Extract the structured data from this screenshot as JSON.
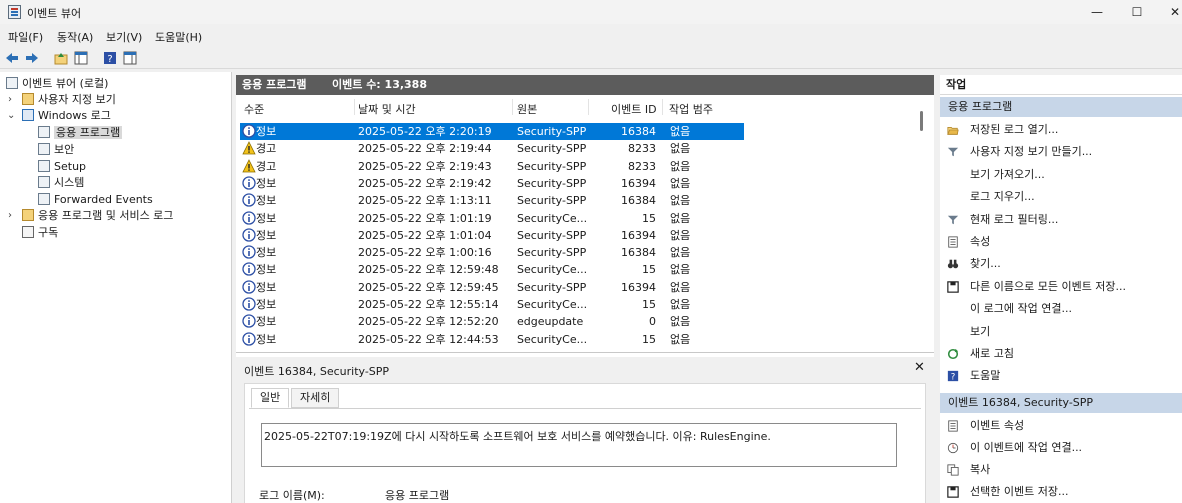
{
  "window": {
    "title": "이벤트 뷰어",
    "minimize": "—",
    "maximize": "☐",
    "close": "✕"
  },
  "menu": [
    "파일(F)",
    "동작(A)",
    "보기(V)",
    "도움말(H)"
  ],
  "tree": {
    "root": "이벤트 뷰어 (로컬)",
    "custom_views": "사용자 지정 보기",
    "windows_logs": "Windows 로그",
    "logs": [
      "응용 프로그램",
      "보안",
      "Setup",
      "시스템",
      "Forwarded Events"
    ],
    "app_service_logs": "응용 프로그램 및 서비스 로그",
    "subscriptions": "구독"
  },
  "center": {
    "log_name": "응용 프로그램",
    "count_label": "이벤트 수: 13,388",
    "columns": [
      "수준",
      "날짜 및 시간",
      "원본",
      "이벤트 ID",
      "작업 범주"
    ],
    "rows": [
      {
        "level": "정보",
        "kind": "info",
        "datetime": "2025-05-22 오후 2:20:19",
        "source": "Security-SPP",
        "id": "16384",
        "category": "없음"
      },
      {
        "level": "경고",
        "kind": "warn",
        "datetime": "2025-05-22 오후 2:19:44",
        "source": "Security-SPP",
        "id": "8233",
        "category": "없음"
      },
      {
        "level": "경고",
        "kind": "warn",
        "datetime": "2025-05-22 오후 2:19:43",
        "source": "Security-SPP",
        "id": "8233",
        "category": "없음"
      },
      {
        "level": "정보",
        "kind": "info",
        "datetime": "2025-05-22 오후 2:19:42",
        "source": "Security-SPP",
        "id": "16394",
        "category": "없음"
      },
      {
        "level": "정보",
        "kind": "info",
        "datetime": "2025-05-22 오후 1:13:11",
        "source": "Security-SPP",
        "id": "16384",
        "category": "없음"
      },
      {
        "level": "정보",
        "kind": "info",
        "datetime": "2025-05-22 오후 1:01:19",
        "source": "SecurityCe...",
        "id": "15",
        "category": "없음"
      },
      {
        "level": "정보",
        "kind": "info",
        "datetime": "2025-05-22 오후 1:01:04",
        "source": "Security-SPP",
        "id": "16394",
        "category": "없음"
      },
      {
        "level": "정보",
        "kind": "info",
        "datetime": "2025-05-22 오후 1:00:16",
        "source": "Security-SPP",
        "id": "16384",
        "category": "없음"
      },
      {
        "level": "정보",
        "kind": "info",
        "datetime": "2025-05-22 오후 12:59:48",
        "source": "SecurityCe...",
        "id": "15",
        "category": "없음"
      },
      {
        "level": "정보",
        "kind": "info",
        "datetime": "2025-05-22 오후 12:59:45",
        "source": "Security-SPP",
        "id": "16394",
        "category": "없음"
      },
      {
        "level": "정보",
        "kind": "info",
        "datetime": "2025-05-22 오후 12:55:14",
        "source": "SecurityCe...",
        "id": "15",
        "category": "없음"
      },
      {
        "level": "정보",
        "kind": "info",
        "datetime": "2025-05-22 오후 12:52:20",
        "source": "edgeupdate",
        "id": "0",
        "category": "없음"
      },
      {
        "level": "정보",
        "kind": "info",
        "datetime": "2025-05-22 오후 12:44:53",
        "source": "SecurityCe...",
        "id": "15",
        "category": "없음"
      }
    ]
  },
  "detail": {
    "title": "이벤트 16384, Security-SPP",
    "close": "✕",
    "tabs": [
      "일반",
      "자세히"
    ],
    "message": "2025-05-22T07:19:19Z에 다시 시작하도록 소프트웨어 보호 서비스를 예약했습니다. 이유: RulesEngine.",
    "log_name_label": "로그 이름(M):",
    "log_name_value": "응용 프로그램"
  },
  "actions": {
    "title": "작업",
    "section1": "응용 프로그램",
    "items1": [
      {
        "label": "저장된 로그 열기...",
        "icon": "folder-open-icon"
      },
      {
        "label": "사용자 지정 보기 만들기...",
        "icon": "filter-icon"
      },
      {
        "label": "보기 가져오기...",
        "icon": ""
      },
      {
        "label": "로그 지우기...",
        "icon": ""
      },
      {
        "label": "현재 로그 필터링...",
        "icon": "filter-icon"
      },
      {
        "label": "속성",
        "icon": "properties-icon"
      },
      {
        "label": "찾기...",
        "icon": "binoculars-icon"
      },
      {
        "label": "다른 이름으로 모든 이벤트 저장...",
        "icon": "save-icon"
      },
      {
        "label": "이 로그에 작업 연결...",
        "icon": ""
      },
      {
        "label": "보기",
        "icon": ""
      },
      {
        "label": "새로 고침",
        "icon": "refresh-icon"
      },
      {
        "label": "도움말",
        "icon": "help-icon"
      }
    ],
    "section2": "이벤트 16384, Security-SPP",
    "items2": [
      {
        "label": "이벤트 속성",
        "icon": "properties-icon"
      },
      {
        "label": "이 이벤트에 작업 연결...",
        "icon": "task-icon"
      },
      {
        "label": "복사",
        "icon": "copy-icon"
      },
      {
        "label": "선택한 이벤트 저장...",
        "icon": "save-icon"
      }
    ]
  }
}
